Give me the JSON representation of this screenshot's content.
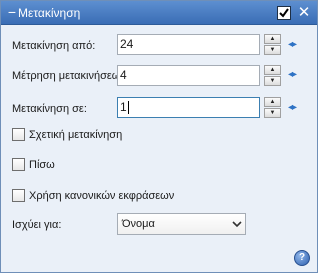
{
  "panel": {
    "title": "Μετακίνηση",
    "collapse_glyph": "−",
    "enabled": true,
    "close_glyph": "✕",
    "title_color": "#3a6db5"
  },
  "rows": [
    {
      "label": "Μετακίνηση από:",
      "value": "24"
    },
    {
      "label": "Μέτρηση μετακινήσεω",
      "value": "4"
    },
    {
      "label": "Μετακίνηση σε:",
      "value": "1"
    }
  ],
  "spin": {
    "up_glyph": "▲",
    "down_glyph": "▼"
  },
  "link_icon": {
    "name": "swap-arrows-icon",
    "glyph": "◂▸"
  },
  "checkboxes": [
    {
      "label": "Σχετική μετακίνηση",
      "checked": false
    },
    {
      "label": "Πίσω",
      "checked": false
    },
    {
      "label": "Χρήση κανονικών εκφράσεων",
      "checked": false
    }
  ],
  "applies_to": {
    "label": "Ισχύει για:",
    "selected": "Όνομα"
  },
  "help": {
    "glyph": "?"
  }
}
